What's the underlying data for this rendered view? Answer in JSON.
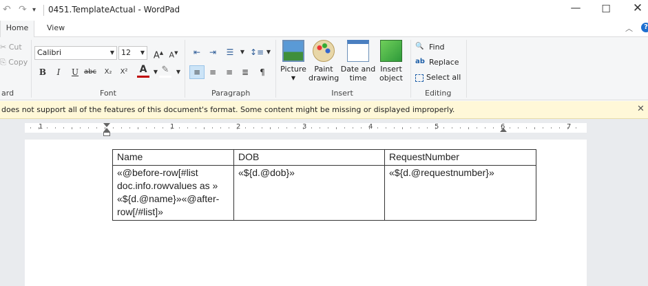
{
  "titlebar": {
    "title": "0451.TemplateActual - WordPad",
    "undo_icon": "undo-icon",
    "redo_icon": "redo-icon",
    "minimize": "—",
    "maximize": "☐",
    "close": "✕"
  },
  "tabs": {
    "home": "Home",
    "view": "View"
  },
  "clipboard": {
    "cut": "Cut",
    "copy": "Copy",
    "label": "ard"
  },
  "font": {
    "family": "Calibri",
    "size": "12",
    "grow": "A",
    "shrink": "A",
    "bold": "B",
    "italic": "I",
    "underline": "U",
    "strike": "abc",
    "sub": "X₂",
    "sup": "X²",
    "color_letter": "A",
    "label": "Font"
  },
  "paragraph": {
    "label": "Paragraph"
  },
  "insert": {
    "picture_l1": "Picture",
    "paint_l1": "Paint",
    "paint_l2": "drawing",
    "date_l1": "Date and",
    "date_l2": "time",
    "object_l1": "Insert",
    "object_l2": "object",
    "label": "Insert"
  },
  "editing": {
    "find": "Find",
    "replace": "Replace",
    "select_all": "Select all",
    "label": "Editing"
  },
  "infobar": {
    "message": "does not support all of the features of this document's format. Some content might be missing or displayed improperly.",
    "close": "✕"
  },
  "ruler": {
    "numbers": [
      "1",
      "1",
      "2",
      "3",
      "4",
      "5",
      "6",
      "7"
    ]
  },
  "table": {
    "headers": [
      "Name",
      "DOB",
      "RequestNumber"
    ],
    "row": {
      "name_l1": "«@before-row[#list",
      "name_l2": "doc.info.rowvalues as »",
      "name_l3": "«${d.@name}»«@after-",
      "name_l4": "row[/#list]»",
      "dob": "«${d.@dob}»",
      "request": "«${d.@requestnumber}»"
    }
  },
  "colors": {
    "accent": "#1e6fd0",
    "selection": "#cce4f7",
    "infobar": "#fff8d8"
  }
}
